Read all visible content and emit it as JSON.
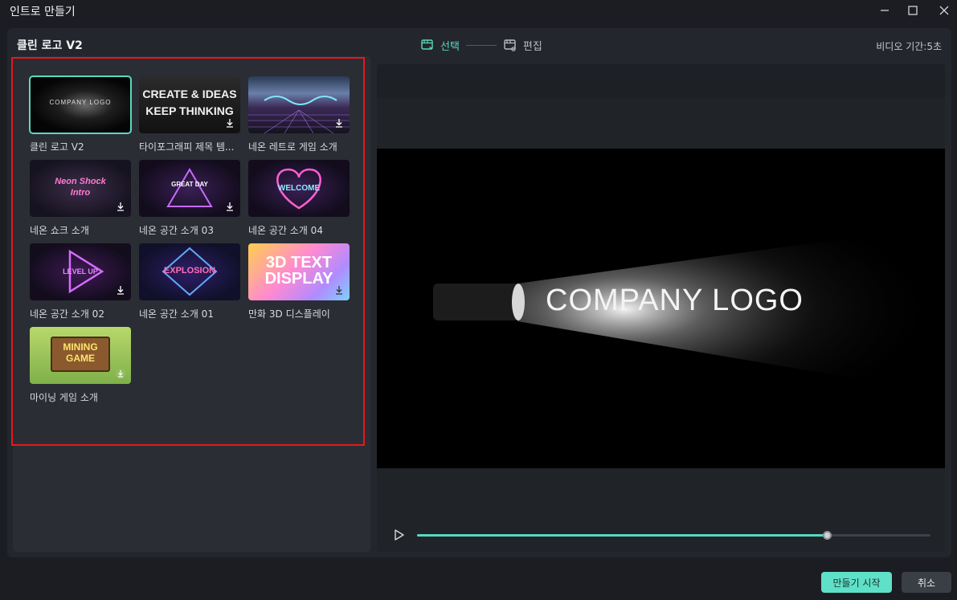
{
  "window": {
    "title": "인트로 만들기",
    "controls": [
      "minimize-icon",
      "maximize-icon",
      "close-icon"
    ]
  },
  "header": {
    "template_name": "클린 로고 V2",
    "steps": [
      {
        "label": "선택",
        "icon": "select-film-icon",
        "active": true
      },
      {
        "label": "편집",
        "icon": "edit-film-icon",
        "active": false
      }
    ],
    "duration": "비디오 기간:5초"
  },
  "templates": [
    {
      "label": "클린 로고 V2",
      "selected": true,
      "downloadable": false,
      "thumb_text": "COMPANY LOGO"
    },
    {
      "label": "타이포그래피 제목 템...",
      "selected": false,
      "downloadable": true,
      "thumb_text": "CREATE & IDEAS KEEP THINKING"
    },
    {
      "label": "네온 레트로 게임 소개",
      "selected": false,
      "downloadable": true,
      "thumb_text": ""
    },
    {
      "label": "네온 쇼크 소개",
      "selected": false,
      "downloadable": true,
      "thumb_text": "Neon Shock Intro"
    },
    {
      "label": "네온 공간 소개 03",
      "selected": false,
      "downloadable": true,
      "thumb_text": "GREAT DAY"
    },
    {
      "label": "네온 공간 소개 04",
      "selected": false,
      "downloadable": false,
      "thumb_text": "WELCOME"
    },
    {
      "label": "네온 공간 소개 02",
      "selected": false,
      "downloadable": true,
      "thumb_text": "LEVEL UP"
    },
    {
      "label": "네온 공간 소개 01",
      "selected": false,
      "downloadable": false,
      "thumb_text": "EXPLOSION"
    },
    {
      "label": "만화 3D 디스플레이",
      "selected": false,
      "downloadable": true,
      "thumb_text": "3D TEXT DISPLAY"
    },
    {
      "label": "마이닝 게임 소개",
      "selected": false,
      "downloadable": true,
      "thumb_text": "MINING GAME"
    }
  ],
  "preview": {
    "logo_text": "COMPANY LOGO",
    "progress": 0.8
  },
  "footer": {
    "start_label": "만들기 시작",
    "cancel_label": "취소"
  },
  "colors": {
    "accent": "#58d9c3",
    "highlight_border": "#e3191d",
    "background": "#1b1d22"
  }
}
